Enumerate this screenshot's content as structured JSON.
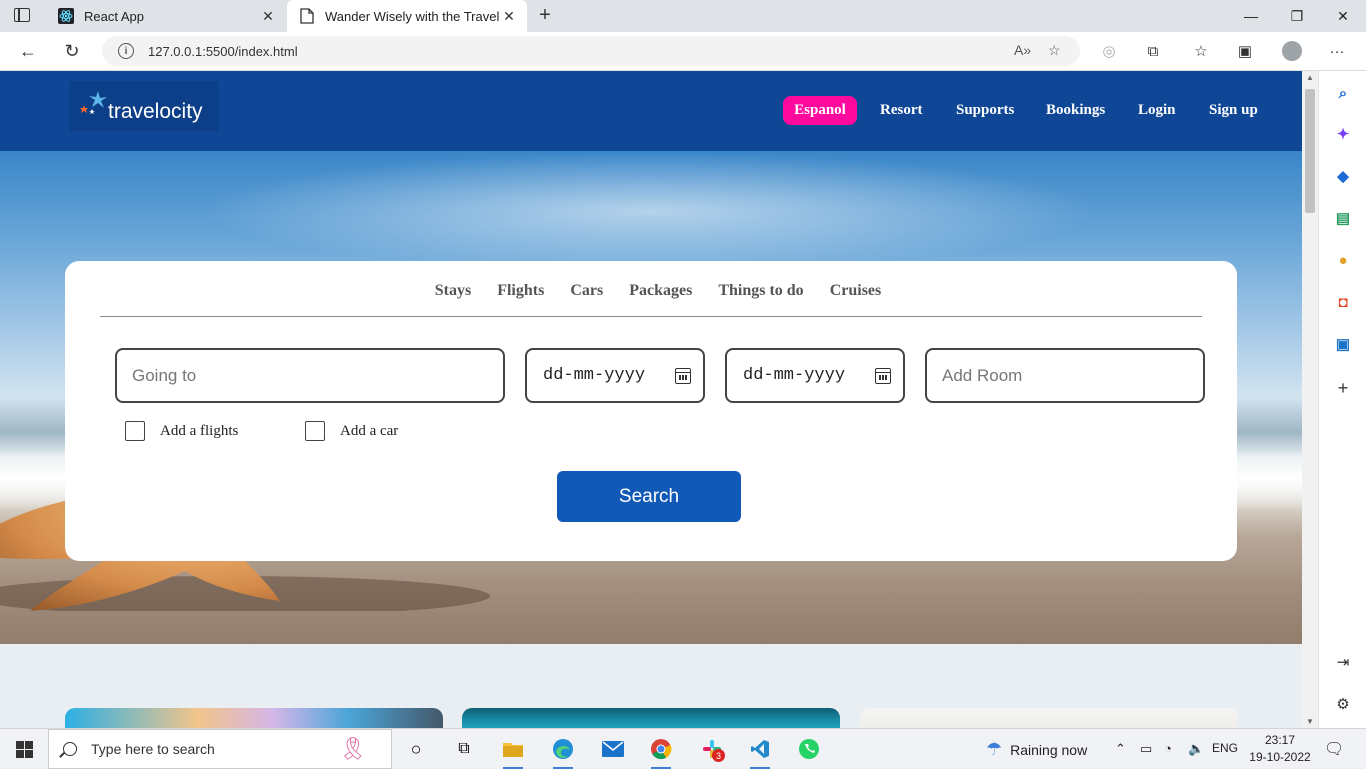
{
  "browser": {
    "tabs": [
      {
        "label": "React App",
        "icon": "react-icon"
      },
      {
        "label": "Wander Wisely with the Traveloc",
        "icon": "page-icon"
      }
    ],
    "url": "127.0.0.1:5500/index.html"
  },
  "site": {
    "brand": "travelocity",
    "nav": {
      "espanol": "Espanol",
      "resort": "Resort",
      "supports": "Supports",
      "bookings": "Bookings",
      "login": "Login",
      "signup": "Sign up"
    },
    "search_tabs": [
      "Stays",
      "Flights",
      "Cars",
      "Packages",
      "Things to do",
      "Cruises"
    ],
    "fields": {
      "going_placeholder": "Going to",
      "date1_value": "dd-mm-yyyy",
      "date2_value": "dd-mm-yyyy",
      "room_placeholder": "Add Room"
    },
    "checkboxes": {
      "flights": "Add a flights",
      "car": "Add a car"
    },
    "search_button": "Search",
    "colors": {
      "nav_bg": "#0f4796",
      "espanol_bg": "#ff0a9c",
      "search_btn": "#1159b7"
    }
  },
  "taskbar": {
    "search_placeholder": "Type here to search",
    "weather": "Raining now",
    "lang": "ENG",
    "time": "23:17",
    "date": "19-10-2022",
    "slack_badge": "3"
  }
}
